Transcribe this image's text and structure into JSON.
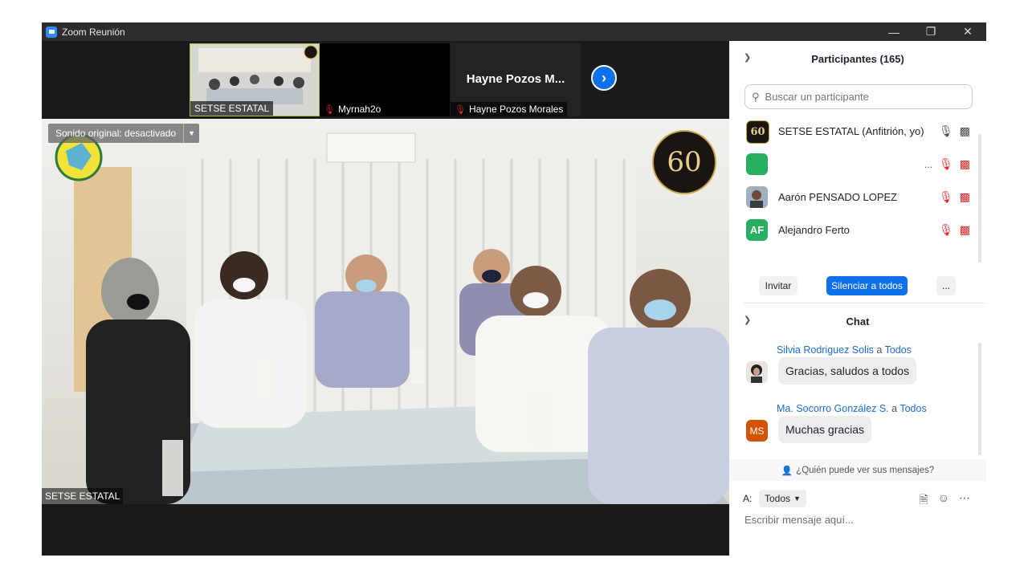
{
  "window": {
    "title": "Zoom Reunión"
  },
  "video": {
    "thumbnails": [
      {
        "name": "SETSE ESTATAL",
        "muted": false
      },
      {
        "name": "Myrnah2o",
        "muted": true
      },
      {
        "name": "Hayne  Pozos Morales",
        "big_name": "Hayne  Pozos M...",
        "muted": true
      }
    ],
    "main": {
      "sound_button": "Sonido original: desactivado",
      "speaker_name": "SETSE ESTATAL",
      "seal_text": "60"
    }
  },
  "participants": {
    "header": "Participantes (165)",
    "search_placeholder": "Buscar un participante",
    "list": [
      {
        "name": "SETSE ESTATAL (Anfitrión, yo)",
        "initials": "60",
        "avatar_color": "#1a1511"
      },
      {
        "name": "",
        "initials": "",
        "avatar_color": "#27ae60",
        "more": "..."
      },
      {
        "name": "Aarón PENSADO LOPEZ",
        "initials": "",
        "avatar_color": "#8a9aa8"
      },
      {
        "name": "Alejandro Ferto",
        "initials": "AF",
        "avatar_color": "#27ae60"
      }
    ],
    "buttons": {
      "invite": "Invitar",
      "mute_all": "Silenciar a todos",
      "more": "..."
    }
  },
  "chat": {
    "header": "Chat",
    "messages": [
      {
        "sender": "Silvia Rodriguez Solis",
        "to_word": "a",
        "to": "Todos",
        "text": "Gracias, saludos a todos",
        "initials": "",
        "avatar_color": "#3b3b3b"
      },
      {
        "sender": "Ma. Socorro González S.",
        "to_word": "a",
        "to": "Todos",
        "text": "Muchas gracias",
        "initials": "MS",
        "avatar_color": "#d35400"
      }
    ],
    "who_can_see": "¿Quién puede ver sus mensajes?",
    "to_label": "A:",
    "to_value": "Todos",
    "input_placeholder": "Escribir mensaje aquí..."
  },
  "colors": {
    "accent": "#0e71eb",
    "muted": "#e02828",
    "brand": "#2D8CFF"
  }
}
